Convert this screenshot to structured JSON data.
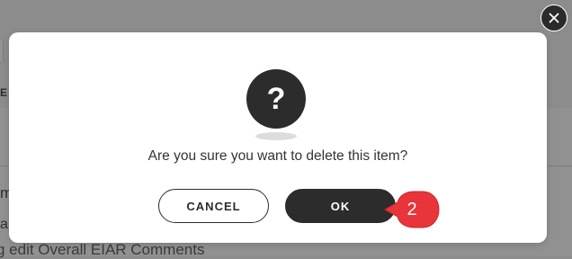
{
  "background": {
    "fragment_e": "E",
    "fragment_m": "m",
    "fragment_all": "all",
    "fragment_comments": "g edit Overall EIAR Comments"
  },
  "close_button": {
    "icon": "close-icon",
    "glyph": "×"
  },
  "dialog": {
    "icon": "question-mark-icon",
    "icon_glyph": "?",
    "message": "Are you sure you want to delete this item?",
    "cancel_label": "CANCEL",
    "ok_label": "OK"
  },
  "callout": {
    "number": "2",
    "color": "#e8343a"
  },
  "colors": {
    "overlay": "#8f8f8f",
    "primary_dark": "#2c2c2c",
    "modal_bg": "#ffffff"
  }
}
